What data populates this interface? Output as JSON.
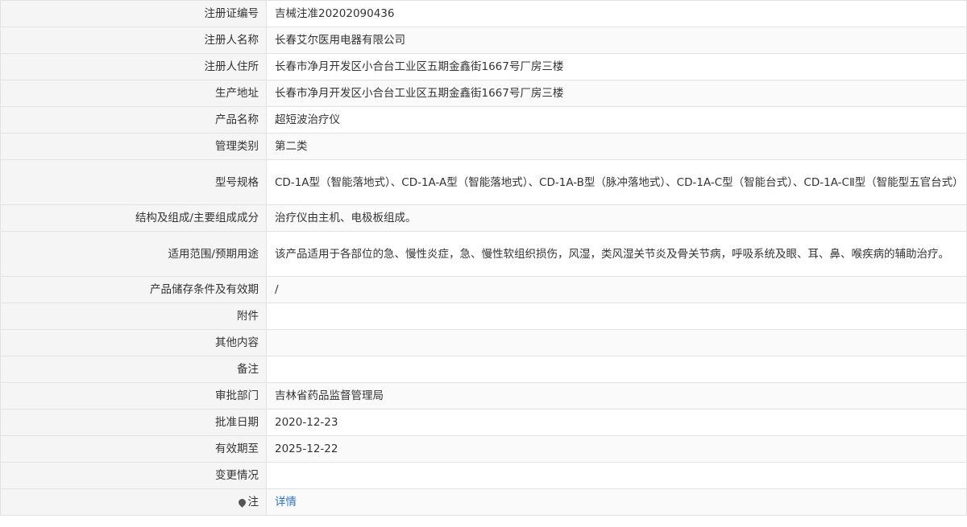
{
  "rows": [
    {
      "label": "注册证编号",
      "value": "吉械注准20202090436"
    },
    {
      "label": "注册人名称",
      "value": "长春艾尔医用电器有限公司"
    },
    {
      "label": "注册人住所",
      "value": "长春市净月开发区小合台工业区五期金鑫街1667号厂房三楼"
    },
    {
      "label": "生产地址",
      "value": "长春市净月开发区小合台工业区五期金鑫街1667号厂房三楼"
    },
    {
      "label": "产品名称",
      "value": "超短波治疗仪"
    },
    {
      "label": "管理类别",
      "value": "第二类"
    },
    {
      "label": "型号规格",
      "value": "CD-1A型（智能落地式）、CD-1A-A型（智能落地式）、CD-1A-B型（脉冲落地式）、CD-1A-C型（智能台式）、CD-1A-CⅡ型（智能型五官台式）"
    },
    {
      "label": "结构及组成/主要组成成分",
      "value": "治疗仪由主机、电极板组成。"
    },
    {
      "label": "适用范围/预期用途",
      "value": "该产品适用于各部位的急、慢性炎症，急、慢性软组织损伤，风湿，类风湿关节炎及骨关节病，呼吸系统及眼、耳、鼻、喉疾病的辅助治疗。"
    },
    {
      "label": "产品储存条件及有效期",
      "value": "/"
    },
    {
      "label": "附件",
      "value": ""
    },
    {
      "label": "其他内容",
      "value": ""
    },
    {
      "label": "备注",
      "value": ""
    },
    {
      "label": "审批部门",
      "value": "吉林省药品监督管理局"
    },
    {
      "label": "批准日期",
      "value": "2020-12-23"
    },
    {
      "label": "有效期至",
      "value": "2025-12-22"
    },
    {
      "label": "变更情况",
      "value": ""
    }
  ],
  "note": {
    "label": "注",
    "link": "详情",
    "icon": "location-pin-icon"
  },
  "colors": {
    "label_bg": "#f5f5f5",
    "border": "#e2e2e2",
    "link": "#2a74d5"
  }
}
